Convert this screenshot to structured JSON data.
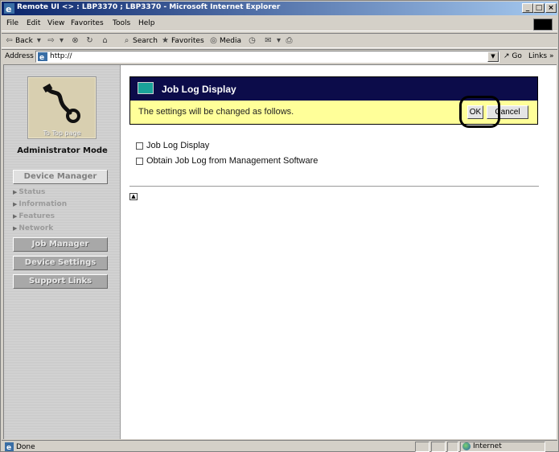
{
  "window": {
    "title": "Remote UI <> : LBP3370 ; LBP3370 - Microsoft Internet Explorer",
    "controls": [
      "minimize",
      "maximize",
      "close"
    ]
  },
  "menubar": {
    "items": [
      "File",
      "Edit",
      "View",
      "Favorites",
      "Tools",
      "Help"
    ]
  },
  "toolbar": {
    "back_label": "Back",
    "search_label": "Search",
    "favorites_label": "Favorites",
    "media_label": "Media"
  },
  "addressbar": {
    "label": "Address",
    "url": "http://",
    "go_label": "Go",
    "links_label": "Links »"
  },
  "sidebar": {
    "top_page_label": "To Top page",
    "mode_label": "Administrator Mode",
    "device_manager_label": "Device Manager",
    "sub_items": [
      "Status",
      "Information",
      "Features",
      "Network"
    ],
    "job_manager_label": "Job Manager",
    "device_settings_label": "Device Settings",
    "support_links_label": "Support Links"
  },
  "main": {
    "title": "Job Log Display",
    "message": "The settings will be changed as follows.",
    "ok_label": "OK",
    "cancel_label": "Cancel",
    "options": [
      {
        "label": "Job Log Display",
        "checked": false
      },
      {
        "label": "Obtain Job Log from Management Software",
        "checked": false
      }
    ]
  },
  "statusbar": {
    "status": "Done",
    "zone": "Internet"
  }
}
